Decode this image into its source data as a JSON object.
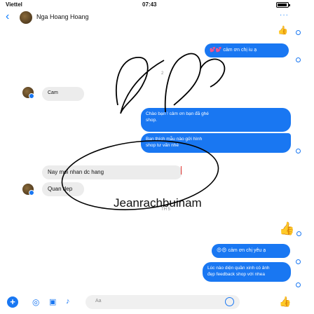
{
  "status_bar": {
    "carrier": "Viettel",
    "time": "07:43"
  },
  "header": {
    "back_glyph": "‹",
    "contact_name": "Nga Hoang Hoang",
    "more_glyph": "···"
  },
  "messages": {
    "out_1": "💕💕 cảm ơn chị iu ạ",
    "in_1_partial": "Cam",
    "out_2_line1": "Chào bạn ! cảm ơn bạn đã ghé",
    "out_2_line2": "shop.",
    "out_2_line3": "Bạn thích mẫu nào gửi hình",
    "out_2_line4": "shop tư vấn nhé",
    "in_2": "Nay moi nhan dc hang",
    "in_3": "Quan dep",
    "out_3": "😍😍 cảm ơn chị yêu ạ",
    "out_4_line1": "Lúc nào diện quần xinh có ảnh",
    "out_4_line2": "đẹp feedback shop với nhea"
  },
  "timestamps": {
    "t1": "2",
    "t2": "TH 5"
  },
  "caption": "Jeanrachbuinam",
  "composer": {
    "plus_glyph": "+",
    "input_placeholder": "Aa"
  },
  "colors": {
    "accent": "#1977f2",
    "received_bubble": "#ececec",
    "ink": "#111111"
  },
  "icons": [
    "back-icon",
    "more-icon",
    "plus-icon",
    "camera-icon",
    "image-icon",
    "mic-icon",
    "emoji-icon",
    "like-icon",
    "seen-icon"
  ]
}
